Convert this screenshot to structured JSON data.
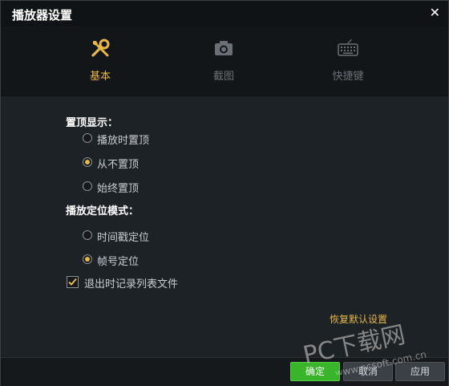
{
  "window": {
    "title": "播放器设置",
    "close_icon": "close-icon"
  },
  "tabs": [
    {
      "label": "基本",
      "icon": "wrench-screwdriver-icon",
      "active": true
    },
    {
      "label": "截图",
      "icon": "camera-icon",
      "active": false
    },
    {
      "label": "快捷键",
      "icon": "keyboard-icon",
      "active": false
    }
  ],
  "sections": {
    "pin_top": {
      "title": "置顶显示：",
      "options": [
        "播放时置顶",
        "从不置顶",
        "始终置顶"
      ],
      "selected": "从不置顶"
    },
    "seek_mode": {
      "title": "播放定位模式：",
      "options": [
        "时间戳定位",
        "帧号定位"
      ],
      "selected": "帧号定位"
    }
  },
  "record_list": {
    "label": "退出时记录列表文件",
    "checked": true
  },
  "restore_defaults": "恢复默认设置",
  "buttons": {
    "ok": "确定",
    "cancel": "取消",
    "apply": "应用"
  },
  "watermark": {
    "line1": "PC下载网",
    "line2": "www.pcsoft.com.cn"
  },
  "colors": {
    "accent": "#e8b84a",
    "primary_button": "#3ab42a",
    "background": "#1d2226"
  }
}
